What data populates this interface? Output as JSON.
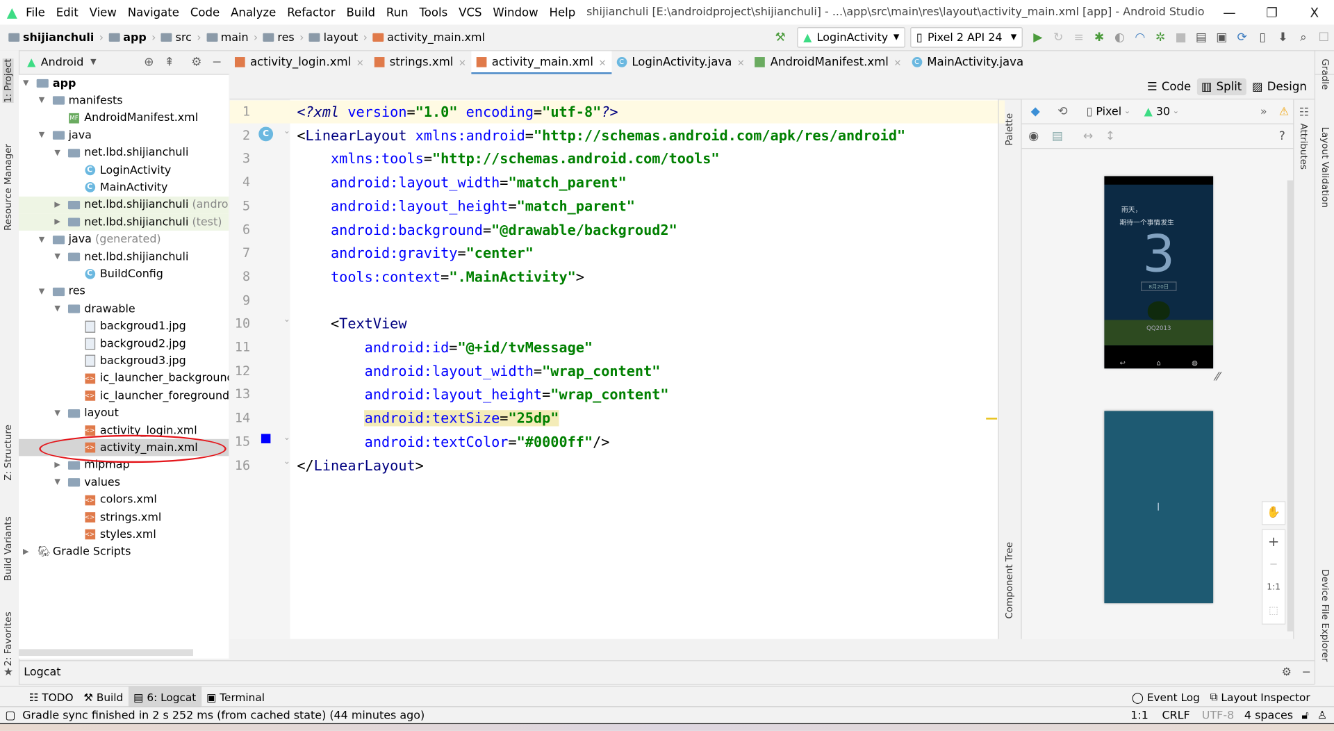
{
  "title_bar": {
    "menu": [
      "File",
      "Edit",
      "View",
      "Navigate",
      "Code",
      "Analyze",
      "Refactor",
      "Build",
      "Run",
      "Tools",
      "VCS",
      "Window",
      "Help"
    ],
    "window_title": "shijianchuli [E:\\androidproject\\shijianchuli] - ...\\app\\src\\main\\res\\layout\\activity_main.xml [app] - Android Studio",
    "minimize": "—",
    "restore": "❐",
    "close": "X"
  },
  "breadcrumb": [
    "shijianchuli",
    "app",
    "src",
    "main",
    "res",
    "layout",
    "activity_main.xml"
  ],
  "toolbar": {
    "run_config": "LoginActivity",
    "device": "Pixel 2 API 24"
  },
  "project_panel": {
    "view": "Android"
  },
  "tree": [
    {
      "label": "app",
      "depth": 0,
      "icon": "folder",
      "arrow": "open",
      "bold": true
    },
    {
      "label": "manifests",
      "depth": 1,
      "icon": "folder",
      "arrow": "open"
    },
    {
      "label": "AndroidManifest.xml",
      "depth": 2,
      "icon": "mf"
    },
    {
      "label": "java",
      "depth": 1,
      "icon": "folder",
      "arrow": "open"
    },
    {
      "label": "net.lbd.shijianchuli",
      "depth": 2,
      "icon": "folder",
      "arrow": "open"
    },
    {
      "label": "LoginActivity",
      "depth": 3,
      "icon": "class"
    },
    {
      "label": "MainActivity",
      "depth": 3,
      "icon": "class"
    },
    {
      "label": "net.lbd.shijianchuli",
      "suffix": " (androidTest)",
      "depth": 2,
      "icon": "folder",
      "arrow": "closed",
      "test": true
    },
    {
      "label": "net.lbd.shijianchuli",
      "suffix": " (test)",
      "depth": 2,
      "icon": "folder",
      "arrow": "closed",
      "test": true
    },
    {
      "label": "java",
      "suffix": " (generated)",
      "depth": 1,
      "icon": "folder",
      "arrow": "open"
    },
    {
      "label": "net.lbd.shijianchuli",
      "depth": 2,
      "icon": "folder",
      "arrow": "open"
    },
    {
      "label": "BuildConfig",
      "depth": 3,
      "icon": "class"
    },
    {
      "label": "res",
      "depth": 1,
      "icon": "folder",
      "arrow": "open"
    },
    {
      "label": "drawable",
      "depth": 2,
      "icon": "folder",
      "arrow": "open"
    },
    {
      "label": "backgroud1.jpg",
      "depth": 3,
      "icon": "img"
    },
    {
      "label": "backgroud2.jpg",
      "depth": 3,
      "icon": "img"
    },
    {
      "label": "backgroud3.jpg",
      "depth": 3,
      "icon": "img"
    },
    {
      "label": "ic_launcher_background.x",
      "depth": 3,
      "icon": "xml"
    },
    {
      "label": "ic_launcher_foreground.x",
      "depth": 3,
      "icon": "xml"
    },
    {
      "label": "layout",
      "depth": 2,
      "icon": "folder",
      "arrow": "open"
    },
    {
      "label": "activity_login.xml",
      "depth": 3,
      "icon": "xml"
    },
    {
      "label": "activity_main.xml",
      "depth": 3,
      "icon": "xml",
      "selected": true
    },
    {
      "label": "mipmap",
      "depth": 2,
      "icon": "folder",
      "arrow": "closed"
    },
    {
      "label": "values",
      "depth": 2,
      "icon": "folder",
      "arrow": "open"
    },
    {
      "label": "colors.xml",
      "depth": 3,
      "icon": "xml"
    },
    {
      "label": "strings.xml",
      "depth": 3,
      "icon": "xml"
    },
    {
      "label": "styles.xml",
      "depth": 3,
      "icon": "xml"
    },
    {
      "label": "Gradle Scripts",
      "depth": 0,
      "icon": "gradle",
      "arrow": "closed"
    }
  ],
  "editor_tabs": [
    {
      "label": "activity_login.xml",
      "icon": "xml"
    },
    {
      "label": "strings.xml",
      "icon": "xml"
    },
    {
      "label": "activity_main.xml",
      "icon": "xml",
      "active": true
    },
    {
      "label": "LoginActivity.java",
      "icon": "class"
    },
    {
      "label": "AndroidManifest.xml",
      "icon": "mf"
    },
    {
      "label": "MainActivity.java",
      "icon": "class",
      "no_close": true
    }
  ],
  "view_modes": {
    "code": "Code",
    "split": "Split",
    "design": "Design",
    "selected": "Split"
  },
  "code_lines": [
    [
      {
        "t": "<?",
        "c": "pi"
      },
      {
        "t": "xml ",
        "c": "pi"
      },
      {
        "t": "version",
        "c": "attr"
      },
      {
        "t": "=",
        "c": "punct"
      },
      {
        "t": "\"1.0\"",
        "c": "val"
      },
      {
        "t": " encoding",
        "c": "attr"
      },
      {
        "t": "=",
        "c": "punct"
      },
      {
        "t": "\"utf-8\"",
        "c": "val"
      },
      {
        "t": "?>",
        "c": "pi"
      }
    ],
    [
      {
        "t": "<",
        "c": "punct"
      },
      {
        "t": "LinearLayout ",
        "c": "tag"
      },
      {
        "t": "xmlns:android",
        "c": "attr"
      },
      {
        "t": "=",
        "c": "punct"
      },
      {
        "t": "\"http://schemas.android.com/apk/res/android\"",
        "c": "val"
      }
    ],
    [
      {
        "t": "    xmlns:tools",
        "c": "attr"
      },
      {
        "t": "=",
        "c": "punct"
      },
      {
        "t": "\"http://schemas.android.com/tools\"",
        "c": "val"
      }
    ],
    [
      {
        "t": "    android:layout_width",
        "c": "attr"
      },
      {
        "t": "=",
        "c": "punct"
      },
      {
        "t": "\"match_parent\"",
        "c": "val"
      }
    ],
    [
      {
        "t": "    android:layout_height",
        "c": "attr"
      },
      {
        "t": "=",
        "c": "punct"
      },
      {
        "t": "\"match_parent\"",
        "c": "val"
      }
    ],
    [
      {
        "t": "    android:background",
        "c": "attr"
      },
      {
        "t": "=",
        "c": "punct"
      },
      {
        "t": "\"@drawable/backgroud2\"",
        "c": "val"
      }
    ],
    [
      {
        "t": "    android:gravity",
        "c": "attr"
      },
      {
        "t": "=",
        "c": "punct"
      },
      {
        "t": "\"center\"",
        "c": "val"
      }
    ],
    [
      {
        "t": "    tools:context",
        "c": "attr"
      },
      {
        "t": "=",
        "c": "punct"
      },
      {
        "t": "\".MainActivity\"",
        "c": "val"
      },
      {
        "t": ">",
        "c": "punct"
      }
    ],
    [],
    [
      {
        "t": "    <",
        "c": "punct"
      },
      {
        "t": "TextView",
        "c": "tag"
      }
    ],
    [
      {
        "t": "        android:id",
        "c": "attr"
      },
      {
        "t": "=",
        "c": "punct"
      },
      {
        "t": "\"@+id/tvMessage\"",
        "c": "val"
      }
    ],
    [
      {
        "t": "        android:layout_width",
        "c": "attr"
      },
      {
        "t": "=",
        "c": "punct"
      },
      {
        "t": "\"wrap_content\"",
        "c": "val"
      }
    ],
    [
      {
        "t": "        android:layout_height",
        "c": "attr"
      },
      {
        "t": "=",
        "c": "punct"
      },
      {
        "t": "\"wrap_content\"",
        "c": "val"
      }
    ],
    [
      {
        "t": "        ",
        "c": "punct"
      },
      {
        "t": "android:textSize",
        "c": "attr",
        "hl": true
      },
      {
        "t": "=",
        "c": "punct",
        "hl": true
      },
      {
        "t": "\"25dp\"",
        "c": "val",
        "hl": true
      }
    ],
    [
      {
        "t": "        android:textColor",
        "c": "attr"
      },
      {
        "t": "=",
        "c": "punct"
      },
      {
        "t": "\"#0000ff\"",
        "c": "val"
      },
      {
        "t": "/>",
        "c": "punct"
      }
    ],
    [
      {
        "t": "</",
        "c": "punct"
      },
      {
        "t": "LinearLayout",
        "c": "tag"
      },
      {
        "t": ">",
        "c": "punct"
      }
    ]
  ],
  "design_toolbar": {
    "device": "Pixel",
    "api": "30"
  },
  "preview": {
    "text_line1": "雨天，",
    "text_line2": "期待一个事情发生",
    "date": "8月20日",
    "brand": "QQ2013"
  },
  "zoom_controls": {
    "plus": "+",
    "minus": "−",
    "one_to_one": "1:1"
  },
  "side_labels": {
    "left": [
      "1: Project",
      "Resource Manager",
      "Z: Structure",
      "Build Variants",
      "2: Favorites"
    ],
    "palette": "Palette",
    "component_tree": "Component Tree",
    "attributes": "Attributes",
    "right": [
      "Gradle",
      "Layout Validation",
      "Device File Explorer"
    ]
  },
  "logcat": {
    "title": "Logcat"
  },
  "bottom_tabs": [
    {
      "label": "TODO"
    },
    {
      "label": "Build"
    },
    {
      "label": "6: Logcat",
      "active": true
    },
    {
      "label": "Terminal"
    }
  ],
  "bottom_right_tabs": [
    {
      "label": "Event Log"
    },
    {
      "label": "Layout Inspector"
    }
  ],
  "status": {
    "message": "Gradle sync finished in 2 s 252 ms (from cached state) (44 minutes ago)",
    "position": "1:1",
    "line_sep": "CRLF",
    "encoding": "UTF-8",
    "indent": "4 spaces"
  },
  "colors": {
    "tag": "#000080",
    "attribute": "#0000ff",
    "value": "#008000",
    "accent": "#4a88c7",
    "selection_circle": "#e4161b",
    "text_color_marker": "#0000ff"
  }
}
